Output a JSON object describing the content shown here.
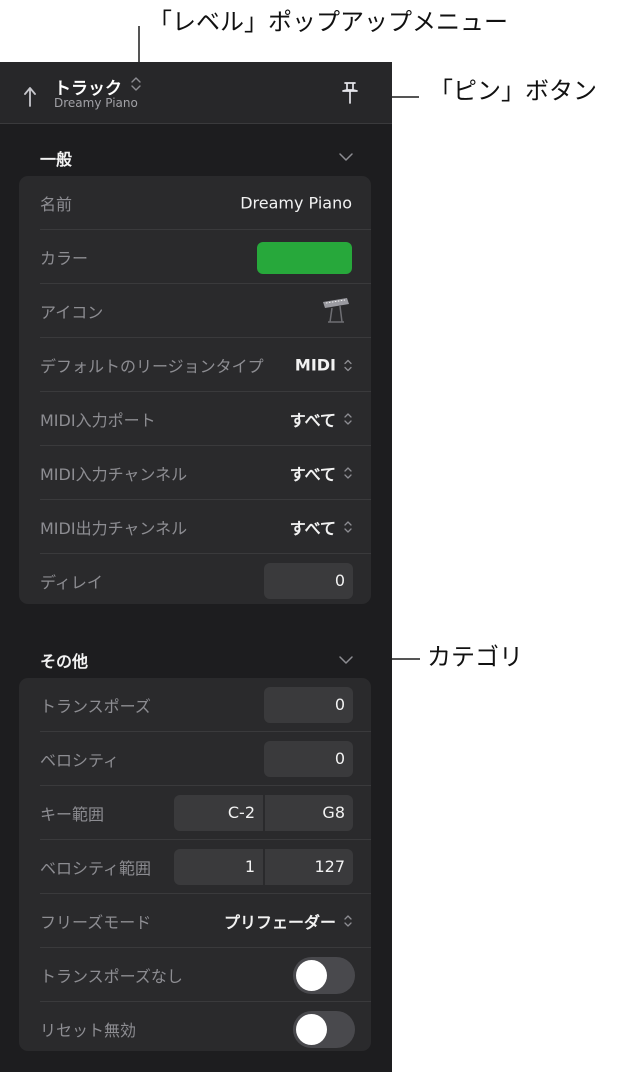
{
  "callouts": {
    "level_menu": "「レベル」ポップアップメニュー",
    "pin_button": "「ピン」ボタン",
    "category": "カテゴリ"
  },
  "header": {
    "title": "トラック",
    "subtitle": "Dreamy Piano"
  },
  "general": {
    "title": "一般",
    "name": {
      "label": "名前",
      "value": "Dreamy Piano"
    },
    "color": {
      "label": "カラー",
      "value": "#27a83b"
    },
    "icon": {
      "label": "アイコン",
      "icon_name": "keyboard-icon"
    },
    "default_region_type": {
      "label": "デフォルトのリージョンタイプ",
      "value": "MIDI"
    },
    "midi_in_port": {
      "label": "MIDI入力ポート",
      "value": "すべて"
    },
    "midi_in_channel": {
      "label": "MIDI入力チャンネル",
      "value": "すべて"
    },
    "midi_out_channel": {
      "label": "MIDI出力チャンネル",
      "value": "すべて"
    },
    "delay": {
      "label": "ディレイ",
      "value": "0"
    }
  },
  "other": {
    "title": "その他",
    "transpose": {
      "label": "トランスポーズ",
      "value": "0"
    },
    "velocity": {
      "label": "ベロシティ",
      "value": "0"
    },
    "key_range": {
      "label": "キー範囲",
      "low": "C-2",
      "high": "G8"
    },
    "velocity_range": {
      "label": "ベロシティ範囲",
      "low": "1",
      "high": "127"
    },
    "freeze_mode": {
      "label": "フリーズモード",
      "value": "プリフェーダー"
    },
    "no_transpose": {
      "label": "トランスポーズなし",
      "on": false
    },
    "reset_disabled": {
      "label": "リセット無効",
      "on": false
    }
  },
  "colors": {
    "panel_bg": "#1d1d1f",
    "card_bg": "#2a2a2c",
    "track_color": "#27a83b"
  }
}
